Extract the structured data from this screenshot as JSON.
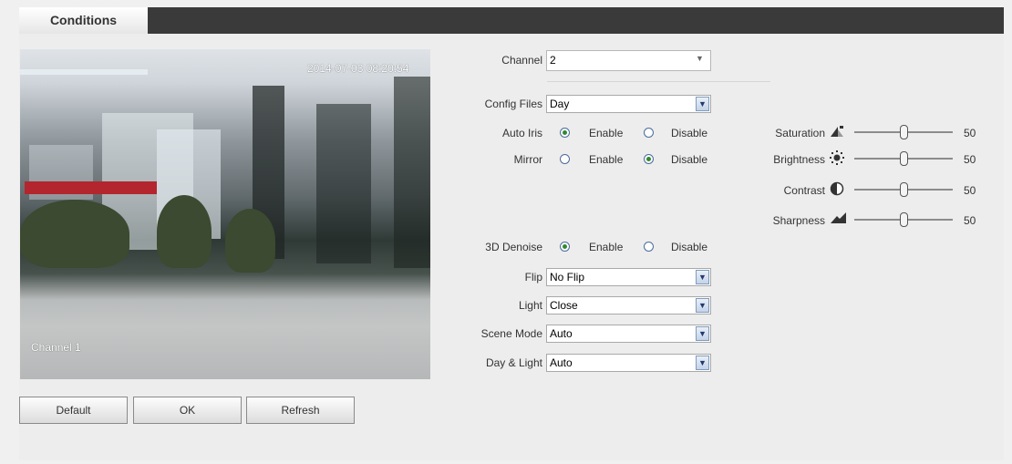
{
  "tab": {
    "label": "Conditions"
  },
  "preview": {
    "timestamp": "2014-07-03 08:20:54",
    "channel_name": "Channel 1"
  },
  "buttons": {
    "default": "Default",
    "ok": "OK",
    "refresh": "Refresh"
  },
  "channel": {
    "label": "Channel",
    "value": "2"
  },
  "config_files": {
    "label": "Config Files",
    "value": "Day"
  },
  "auto_iris": {
    "label": "Auto Iris",
    "enable": "Enable",
    "disable": "Disable",
    "selected": "enable"
  },
  "mirror": {
    "label": "Mirror",
    "enable": "Enable",
    "disable": "Disable",
    "selected": "disable"
  },
  "denoise": {
    "label": "3D Denoise",
    "enable": "Enable",
    "disable": "Disable",
    "selected": "enable"
  },
  "flip": {
    "label": "Flip",
    "value": "No Flip"
  },
  "light": {
    "label": "Light",
    "value": "Close"
  },
  "scene_mode": {
    "label": "Scene Mode",
    "value": "Auto"
  },
  "day_light": {
    "label": "Day & Light",
    "value": "Auto"
  },
  "sliders": {
    "saturation": {
      "label": "Saturation",
      "value": "50",
      "icon": "saturation-icon"
    },
    "brightness": {
      "label": "Brightness",
      "value": "50",
      "icon": "brightness-icon"
    },
    "contrast": {
      "label": "Contrast",
      "value": "50",
      "icon": "contrast-icon"
    },
    "sharpness": {
      "label": "Sharpness",
      "value": "50",
      "icon": "sharpness-icon"
    }
  }
}
